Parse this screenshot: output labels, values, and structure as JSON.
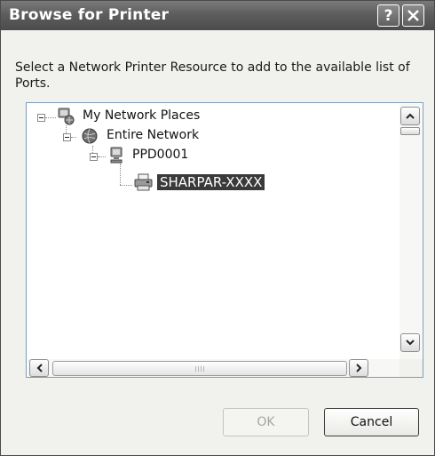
{
  "window": {
    "title": "Browse for Printer",
    "help_glyph": "?"
  },
  "description": "Select a Network Printer Resource to add to the available list of Ports.",
  "tree": {
    "nodes": [
      {
        "label": "My Network Places",
        "icon": "network-places-icon",
        "expanded": true
      },
      {
        "label": "Entire Network",
        "icon": "globe-network-icon",
        "expanded": true
      },
      {
        "label": "PPD0001",
        "icon": "computer-icon",
        "expanded": true
      },
      {
        "label": "SHARPAR-XXXX",
        "icon": "printer-icon",
        "selected": true
      }
    ]
  },
  "buttons": {
    "ok": "OK",
    "cancel": "Cancel"
  },
  "colors": {
    "selection_bg": "#3a3a3a",
    "title_bar": "#5e5e5e",
    "tree_border": "#7f9db9"
  }
}
